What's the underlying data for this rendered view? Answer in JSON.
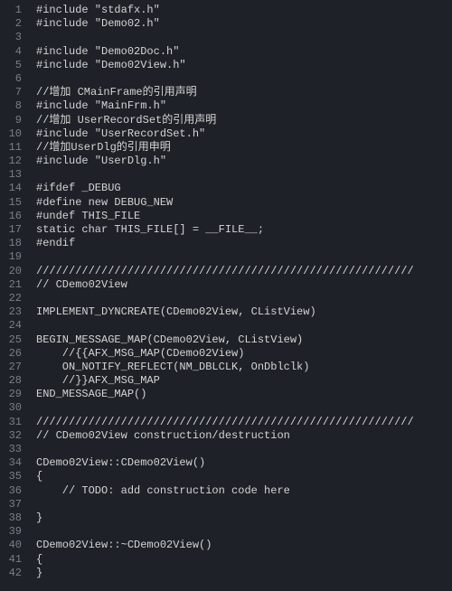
{
  "lines": [
    "#include \"stdafx.h\"",
    "#include \"Demo02.h\"",
    "",
    "#include \"Demo02Doc.h\"",
    "#include \"Demo02View.h\"",
    "",
    "//增加 CMainFrame的引用声明",
    "#include \"MainFrm.h\"",
    "//增加 UserRecordSet的引用声明",
    "#include \"UserRecordSet.h\"",
    "//增加UserDlg的引用申明",
    "#include \"UserDlg.h\"",
    "",
    "#ifdef _DEBUG",
    "#define new DEBUG_NEW",
    "#undef THIS_FILE",
    "static char THIS_FILE[] = __FILE__;",
    "#endif",
    "",
    "//////////////////////////////////////////////////////////",
    "// CDemo02View",
    "",
    "IMPLEMENT_DYNCREATE(CDemo02View, CListView)",
    "",
    "BEGIN_MESSAGE_MAP(CDemo02View, CListView)",
    "    //{{AFX_MSG_MAP(CDemo02View)",
    "    ON_NOTIFY_REFLECT(NM_DBLCLK, OnDblclk)",
    "    //}}AFX_MSG_MAP",
    "END_MESSAGE_MAP()",
    "",
    "//////////////////////////////////////////////////////////",
    "// CDemo02View construction/destruction",
    "",
    "CDemo02View::CDemo02View()",
    "{",
    "    // TODO: add construction code here",
    "",
    "}",
    "",
    "CDemo02View::~CDemo02View()",
    "{",
    "}"
  ]
}
